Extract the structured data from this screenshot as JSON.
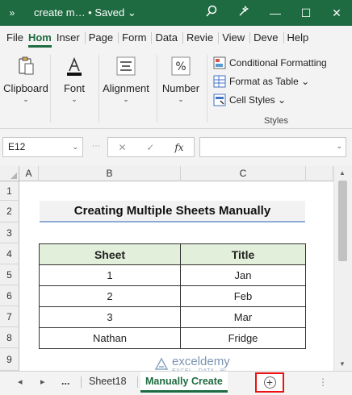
{
  "titlebar": {
    "expand_glyph": "»",
    "title": "create m… • Saved ⌄",
    "icons": [
      "search-icon",
      "wand-icon"
    ],
    "minimize": "—",
    "maximize": "☐",
    "close": "✕"
  },
  "ribbon_tabs": [
    "File",
    "Hom",
    "Inser",
    "Page",
    "Form",
    "Data",
    "Revie",
    "View",
    "Deve",
    "Help"
  ],
  "active_tab": "Hom",
  "ribbon": {
    "groups": [
      {
        "label": "Clipboard",
        "icon": "clipboard-icon"
      },
      {
        "label": "Font",
        "icon": "font-color-icon"
      },
      {
        "label": "Alignment",
        "icon": "align-icon"
      },
      {
        "label": "Number",
        "icon": "percent-icon"
      }
    ],
    "styles": {
      "items": [
        "Conditional Formatting",
        "Format as Table ⌄",
        "Cell Styles ⌄"
      ],
      "label": "Styles"
    }
  },
  "formula_bar": {
    "name_box": "E12",
    "fx": "fx",
    "cancel": "✕",
    "enter": "✓",
    "formula": ""
  },
  "grid": {
    "columns": [
      "A",
      "B",
      "C"
    ],
    "rows": [
      "1",
      "2",
      "3",
      "4",
      "5",
      "6",
      "7",
      "8",
      "9"
    ],
    "title_cell": "Creating Multiple Sheets Manually",
    "table": {
      "headers": [
        "Sheet",
        "Title"
      ],
      "rows": [
        [
          "1",
          "Jan"
        ],
        [
          "2",
          "Feb"
        ],
        [
          "3",
          "Mar"
        ],
        [
          "Nathan",
          "Fridge"
        ]
      ]
    }
  },
  "watermark": {
    "name": "exceldemy",
    "sub": "EXCEL · DATA · BI"
  },
  "sheet_tabs": {
    "prev_dots": "...",
    "items": [
      "Sheet18",
      "Manually Create"
    ],
    "active": "Manually Create"
  },
  "colors": {
    "excel_green": "#1e6b41",
    "header_fill": "#e2efda",
    "highlight": "#e11111"
  }
}
